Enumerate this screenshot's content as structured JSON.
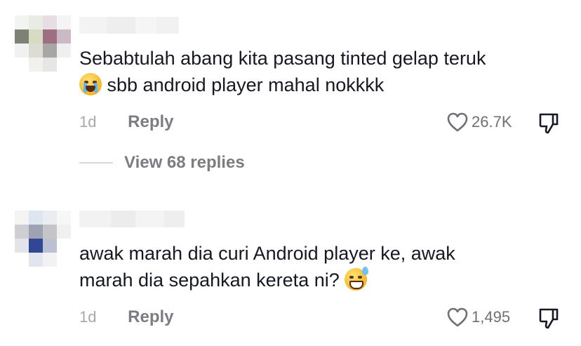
{
  "comments": [
    {
      "text": "Sebabtulah abang kita pasang tinted gelap teruk",
      "text2": "sbb android player mahal nokkkk",
      "emoji": "crying-face-emoji",
      "time": "1d",
      "reply_label": "Reply",
      "likes": "26.7K",
      "view_replies": "View 68 replies"
    },
    {
      "text": "awak marah dia curi Android player ke, awak",
      "text2": "marah dia sepahkan kereta ni?",
      "emoji": "grinning-sweat-emoji",
      "time": "1d",
      "reply_label": "Reply",
      "likes": "1,495"
    }
  ],
  "colors": {
    "text": "#161823",
    "meta": "#8a8b91",
    "divider": "#d7d8db"
  }
}
